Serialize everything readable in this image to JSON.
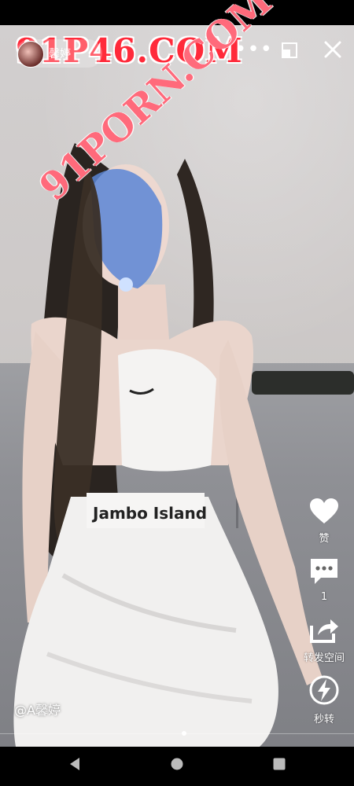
{
  "overlay": {
    "watermark_top": "91P46.COM",
    "watermark_diagonal": "91PORN.COM",
    "avatar_name": "馨婷",
    "author_handle": "@A馨婷",
    "progress_fraction": 0.52
  },
  "side_actions": [
    {
      "name": "like",
      "icon": "heart-icon",
      "label": "赞"
    },
    {
      "name": "comment",
      "icon": "comment-icon",
      "label": "1"
    },
    {
      "name": "share",
      "icon": "share-icon",
      "label": "转发空间"
    },
    {
      "name": "quick-forward",
      "icon": "lightning-icon",
      "label": "秒转"
    }
  ],
  "icons": {
    "more": "more-icon",
    "restore": "restore-window-icon",
    "close": "close-icon",
    "back": "nav-back-icon",
    "home": "nav-home-icon",
    "recents": "nav-recents-icon"
  },
  "colors": {
    "watermark": "#ff2a3a",
    "background": "#000000"
  }
}
